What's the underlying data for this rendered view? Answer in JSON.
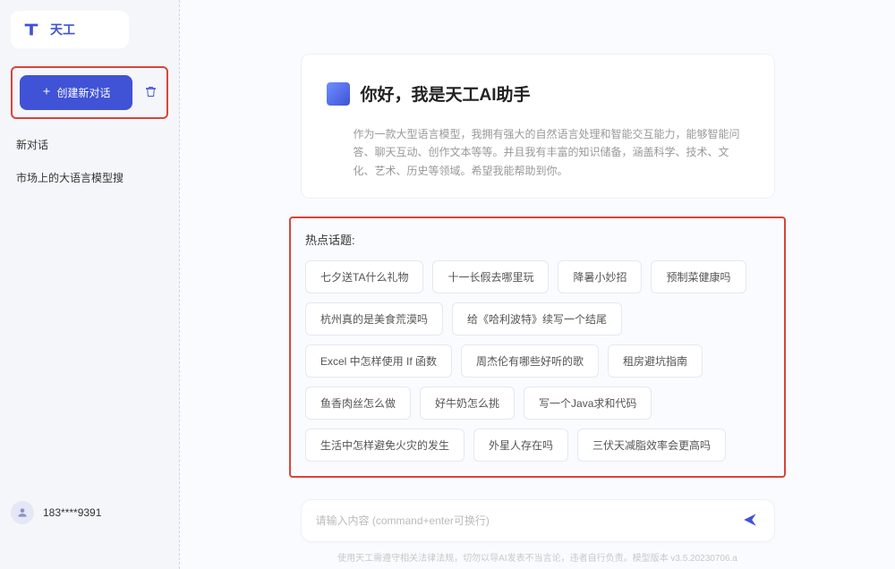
{
  "app": {
    "name": "天工"
  },
  "sidebar": {
    "new_chat_label": "创建新对话",
    "history": [
      {
        "title": "新对话"
      },
      {
        "title": "市场上的大语言模型搜"
      }
    ]
  },
  "user": {
    "name": "183****9391"
  },
  "welcome": {
    "title": "你好，我是天工AI助手",
    "description": "作为一款大型语言模型，我拥有强大的自然语言处理和智能交互能力，能够智能问答、聊天互动、创作文本等等。并且我有丰富的知识储备，涵盖科学、技术、文化、艺术、历史等领域。希望我能帮助到你。"
  },
  "hot_topics": {
    "title": "热点话题:",
    "items": [
      "七夕送TA什么礼物",
      "十一长假去哪里玩",
      "降暑小妙招",
      "预制菜健康吗",
      "杭州真的是美食荒漠吗",
      "给《哈利波特》续写一个结尾",
      "Excel 中怎样使用 If 函数",
      "周杰伦有哪些好听的歌",
      "租房避坑指南",
      "鱼香肉丝怎么做",
      "好牛奶怎么挑",
      "写一个Java求和代码",
      "生活中怎样避免火灾的发生",
      "外星人存在吗",
      "三伏天减脂效率会更高吗"
    ]
  },
  "input": {
    "placeholder": "请输入内容 (command+enter可换行)"
  },
  "footer": {
    "text": "使用天工需遵守相关法律法规，切勿以导AI发表不当言论，违者自行负责。模型版本 v3.5.20230706.a"
  }
}
